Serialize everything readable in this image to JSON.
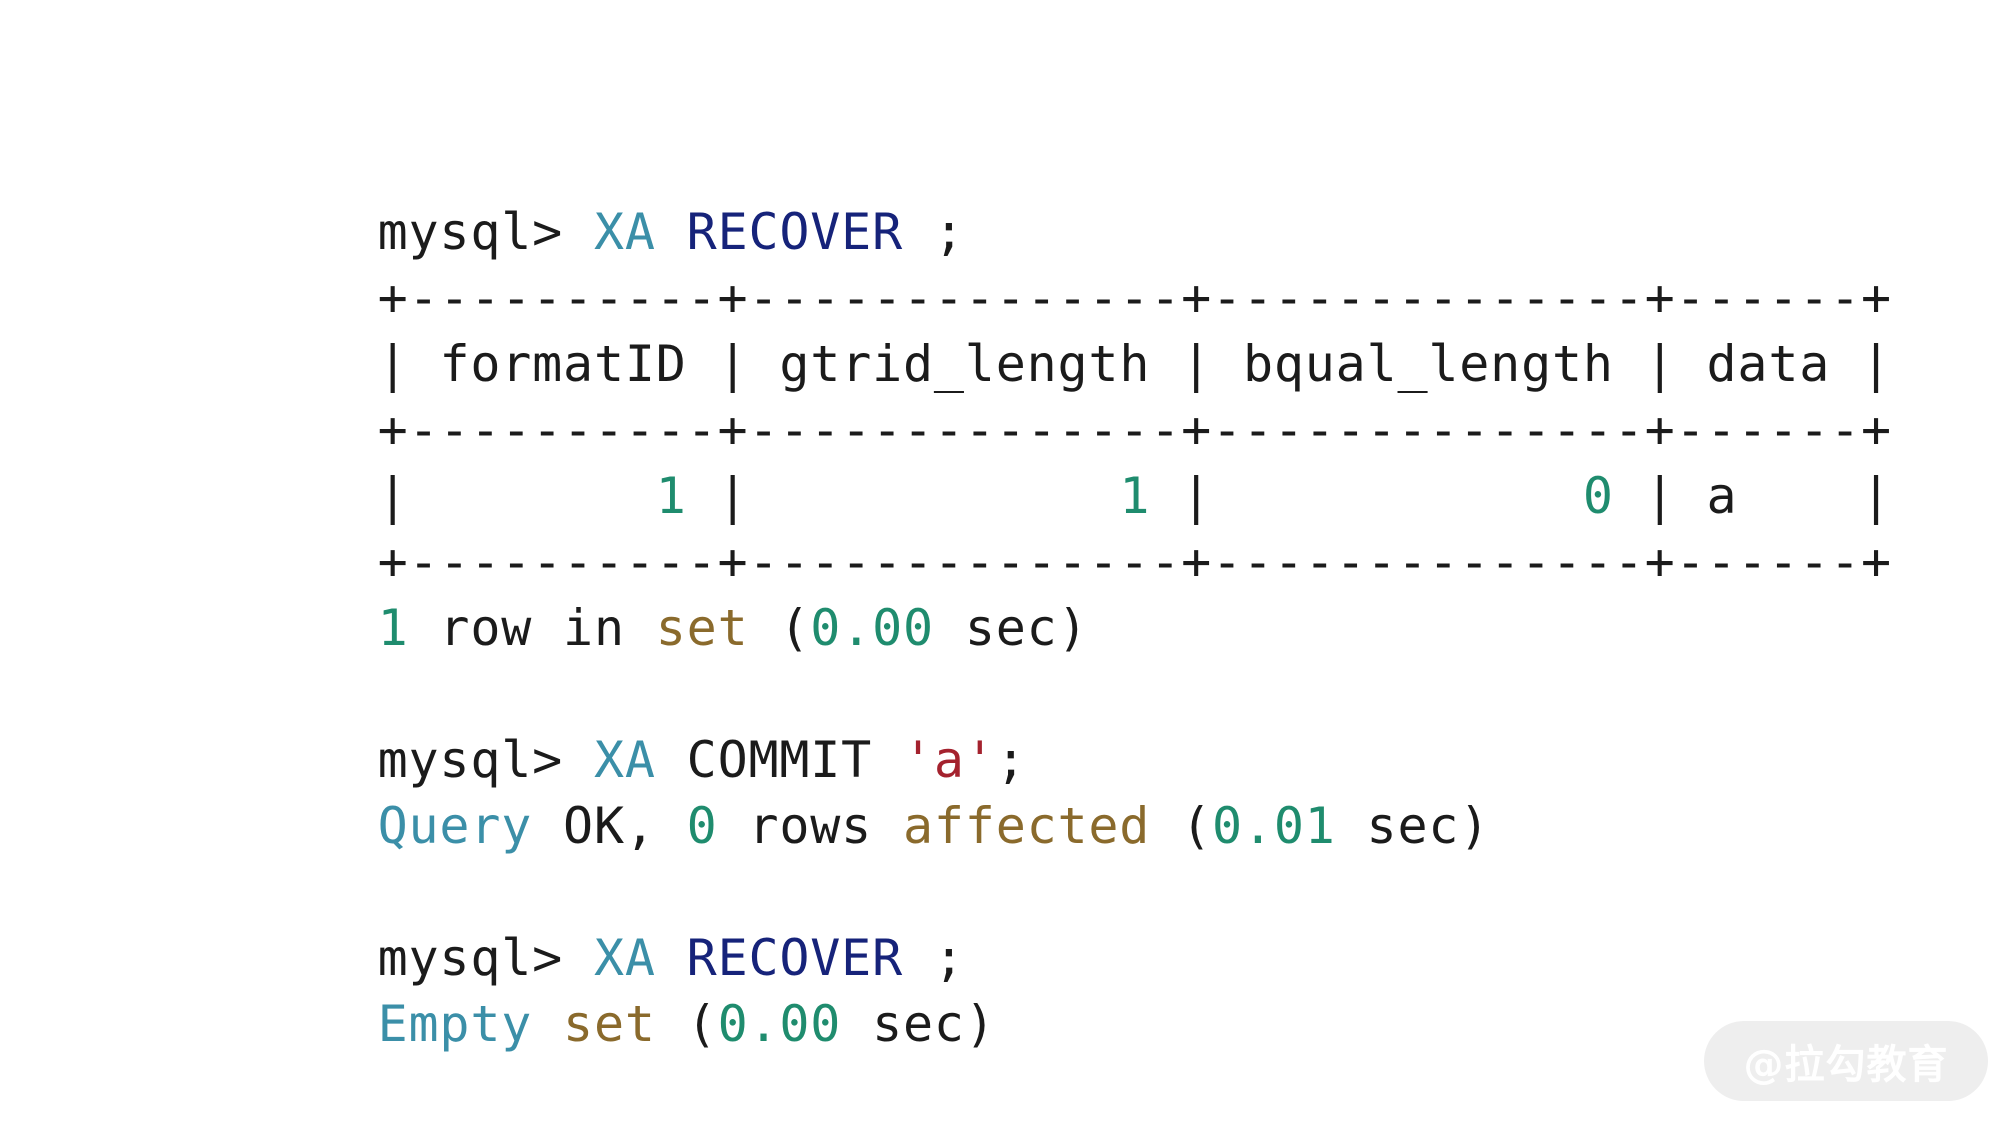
{
  "terminal": {
    "block1": {
      "prompt": "mysql> ",
      "kw1": "XA",
      "space": " ",
      "kw2": "RECOVER",
      "tail": " ;"
    },
    "table": {
      "border": "+----------+--------------+--------------+------+",
      "header": {
        "pipe_start": "| ",
        "col1": "formatID",
        "sep1": " | ",
        "col2": "gtrid_length",
        "sep2": " | ",
        "col3": "bqual_length",
        "sep3": " | ",
        "col4": "data",
        "pipe_end": " |"
      },
      "row": {
        "pipe_start": "| ",
        "pad1": "       ",
        "v1": "1",
        "sep1": " | ",
        "pad2": "           ",
        "v2": "1",
        "sep2": " | ",
        "pad3": "           ",
        "v3": "0",
        "sep3": " | ",
        "v4": "a",
        "pad4": "    ",
        "pipe_end": "|"
      }
    },
    "result1": {
      "n": "1",
      "t1": " row in ",
      "set": "set",
      "t2": " (",
      "time": "0.00",
      "t3": " sec)"
    },
    "block2": {
      "prompt": "mysql> ",
      "kw1": "XA",
      "t1": " COMMIT ",
      "str": "'a'",
      "tail": ";"
    },
    "result2": {
      "query": "Query",
      "t1": " OK, ",
      "n": "0",
      "t2": " rows ",
      "affected": "affected",
      "t3": " (",
      "time": "0.01",
      "t4": " sec)"
    },
    "block3": {
      "prompt": "mysql> ",
      "kw1": "XA",
      "space": " ",
      "kw2": "RECOVER",
      "tail": " ;"
    },
    "result3": {
      "empty": "Empty",
      "t1": " ",
      "set": "set",
      "t2": " (",
      "time": "0.00",
      "t3": " sec)"
    }
  },
  "watermark": {
    "text": "@拉勾教育"
  },
  "colors": {
    "cyan": "#3b8fa8",
    "navy": "#16237a",
    "green": "#1f8c6e",
    "olive": "#8a6a2c",
    "red": "#a4222e",
    "text": "#1b1b1b"
  }
}
